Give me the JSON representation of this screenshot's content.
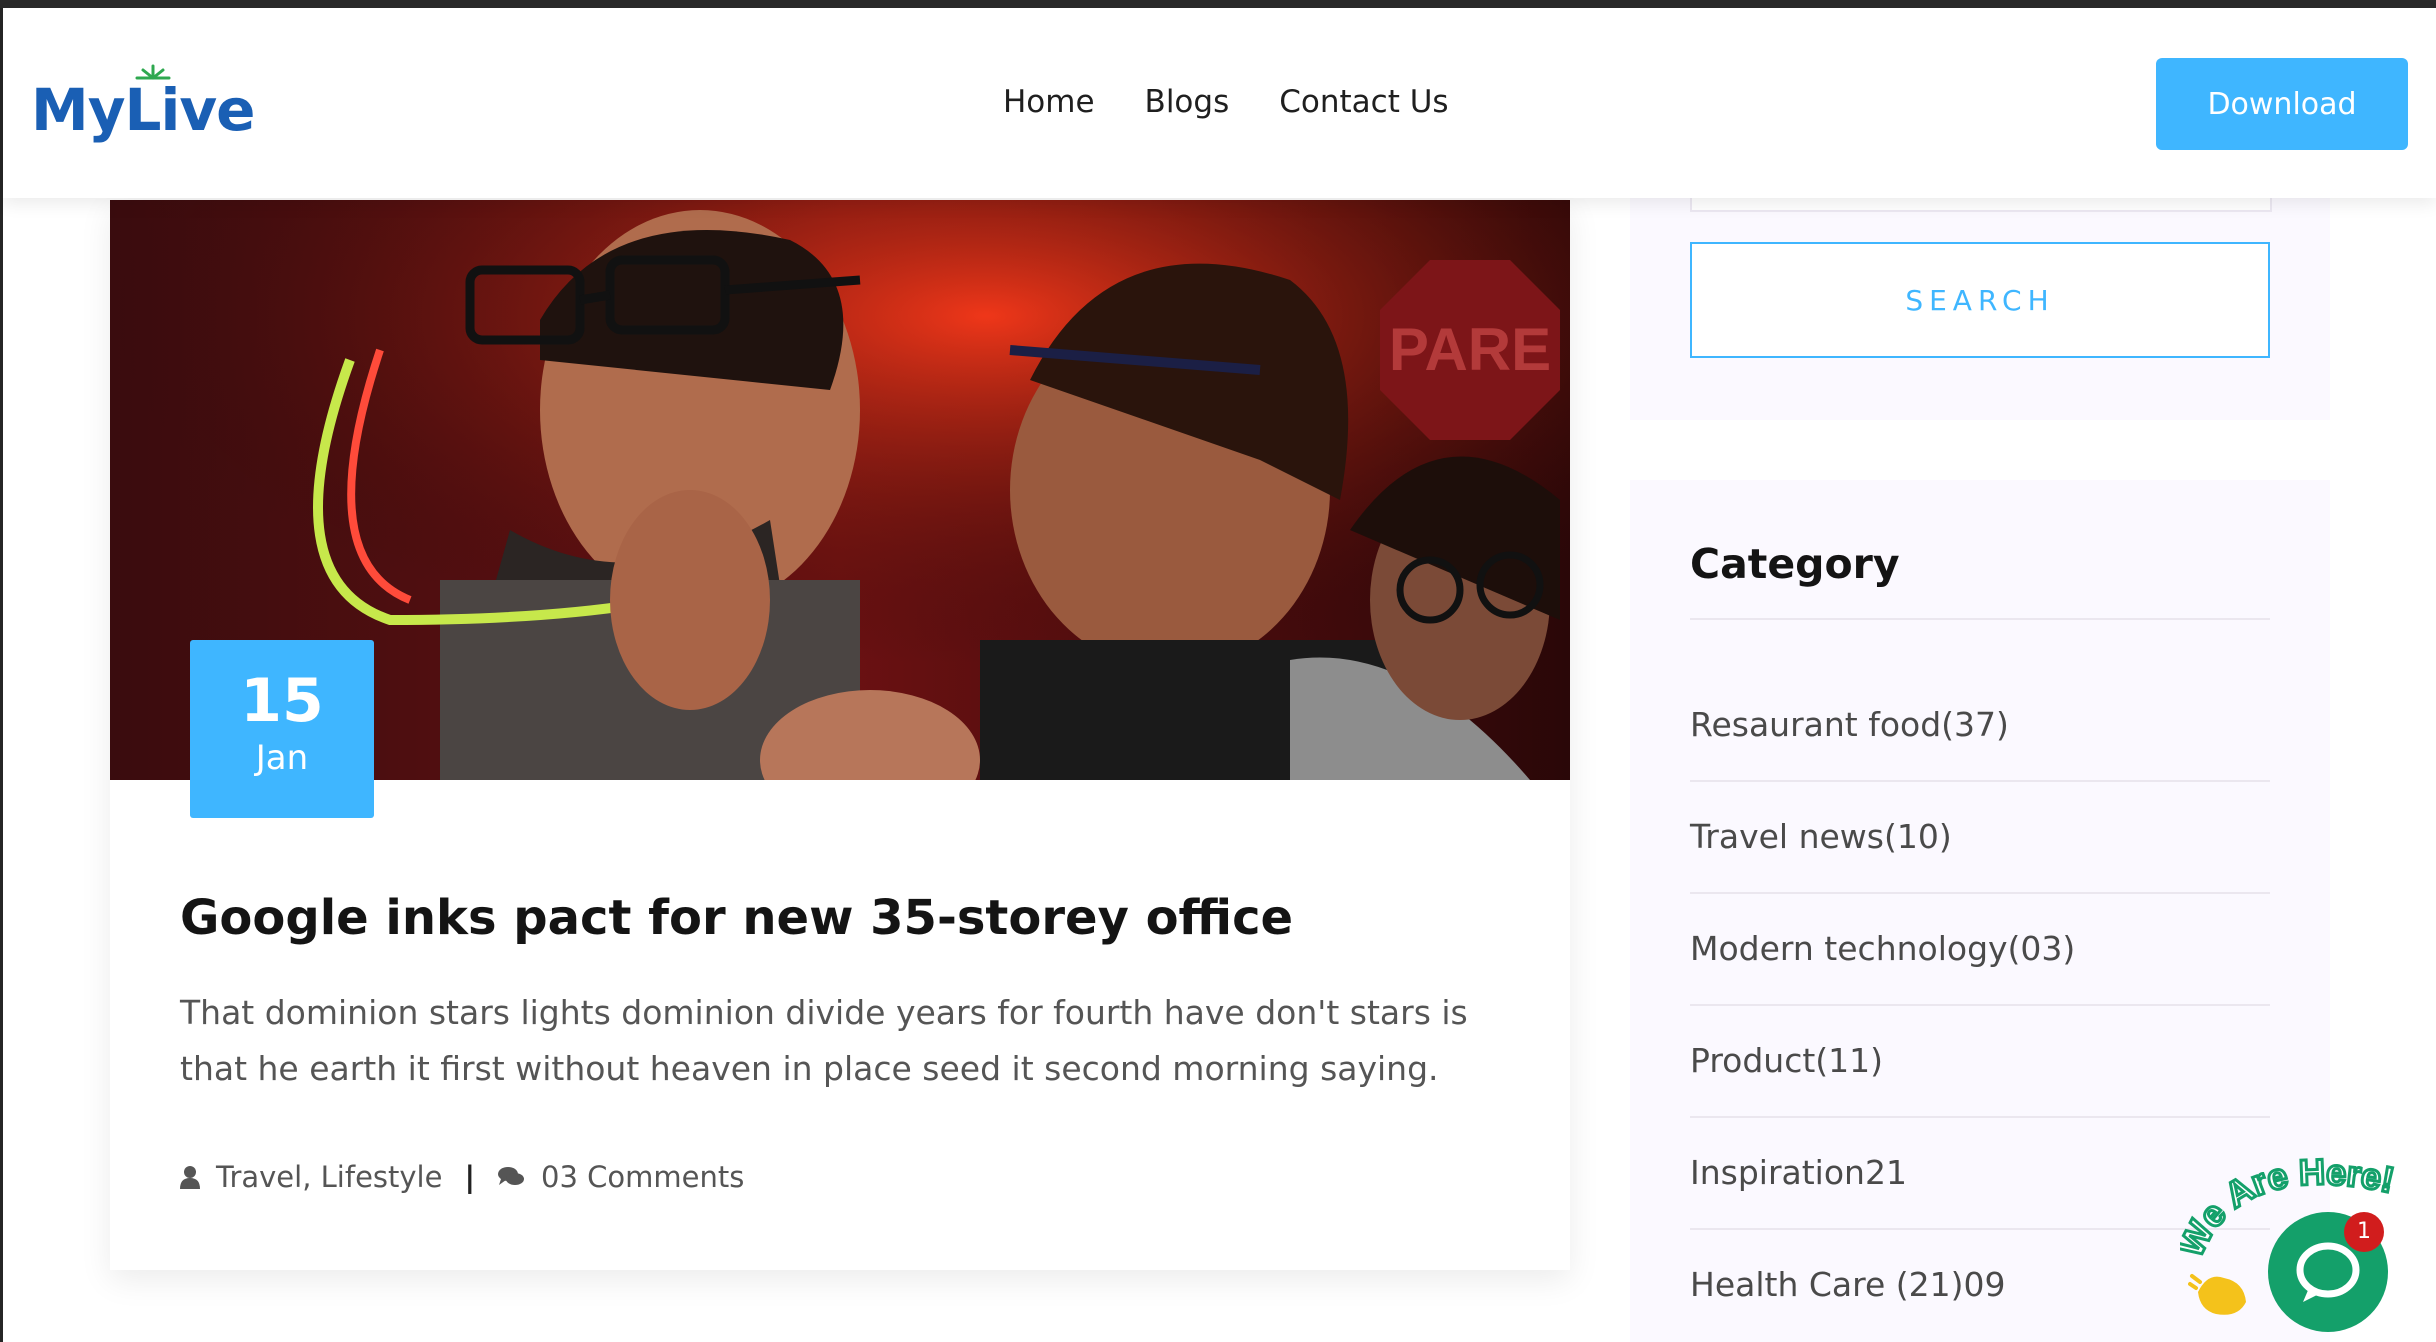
{
  "header": {
    "logo": "MyLive",
    "nav": [
      {
        "label": "Home"
      },
      {
        "label": "Blogs"
      },
      {
        "label": "Contact Us"
      }
    ],
    "download_label": "Download"
  },
  "post": {
    "date_day": "15",
    "date_month": "Jan",
    "title": "Google inks pact for new 35-storey office",
    "excerpt": "That dominion stars lights dominion divide years for fourth have don't stars is that he earth it first without heaven in place seed it second morning saying.",
    "tags": "Travel, Lifestyle",
    "separator": "|",
    "comments": "03 Comments"
  },
  "sidebar": {
    "search_label": "SEARCH",
    "category_title": "Category",
    "categories": [
      {
        "label": "Resaurant food(37)"
      },
      {
        "label": "Travel news(10)"
      },
      {
        "label": "Modern technology(03)"
      },
      {
        "label": "Product(11)"
      },
      {
        "label": "Inspiration21"
      },
      {
        "label": "Health Care (21)09"
      }
    ]
  },
  "chat": {
    "badge_count": "1",
    "banner": "We Are Here!"
  },
  "colors": {
    "accent": "#3fb6ff",
    "logo_blue": "#1a5fb4",
    "chat_green": "#14a06a",
    "badge_red": "#d11d1d"
  }
}
